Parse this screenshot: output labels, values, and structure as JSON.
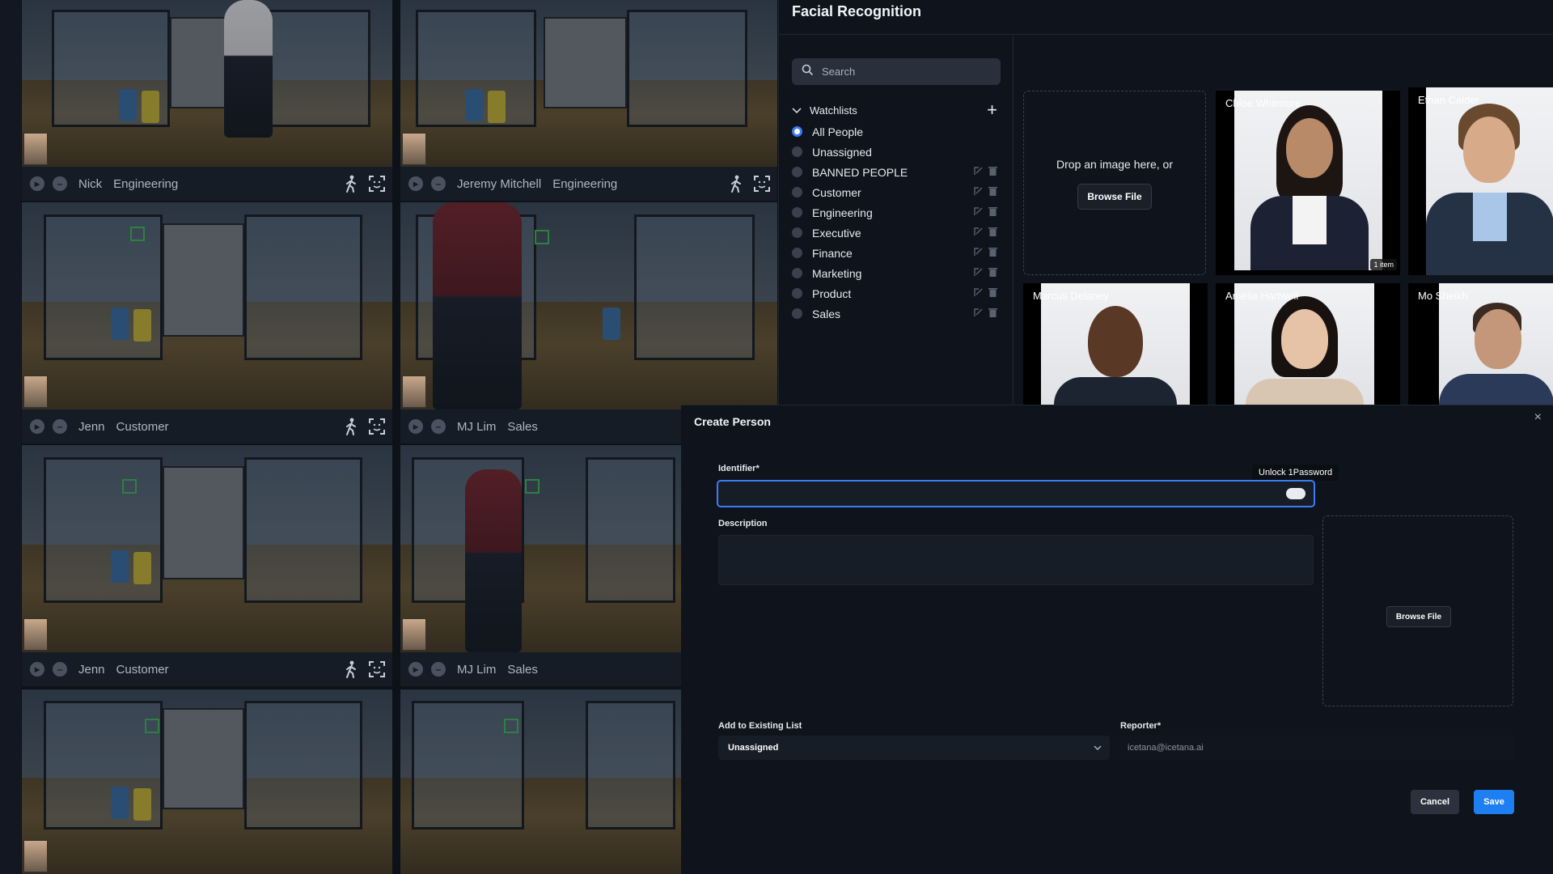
{
  "panel": {
    "title": "Facial Recognition",
    "search_placeholder": "Search",
    "watchlists_label": "Watchlists",
    "watchlists": [
      {
        "label": "All People",
        "selected": true,
        "editable": false
      },
      {
        "label": "Unassigned",
        "selected": false,
        "editable": false
      },
      {
        "label": "BANNED PEOPLE",
        "selected": false,
        "editable": true
      },
      {
        "label": "Customer",
        "selected": false,
        "editable": true
      },
      {
        "label": "Engineering",
        "selected": false,
        "editable": true
      },
      {
        "label": "Executive",
        "selected": false,
        "editable": true
      },
      {
        "label": "Finance",
        "selected": false,
        "editable": true
      },
      {
        "label": "Marketing",
        "selected": false,
        "editable": true
      },
      {
        "label": "Product",
        "selected": false,
        "editable": true
      },
      {
        "label": "Sales",
        "selected": false,
        "editable": true
      }
    ],
    "drop_text": "Drop an image here, or",
    "browse_label": "Browse File",
    "people": [
      {
        "name": "Chloe Whitmore",
        "badge": "1 item"
      },
      {
        "name": "Ethan Calder",
        "badge": ""
      },
      {
        "name": "Marcus Delaney",
        "badge": ""
      },
      {
        "name": "Amelia Hartwell",
        "badge": ""
      },
      {
        "name": "Mo Sheikh",
        "badge": ""
      }
    ]
  },
  "cameras": [
    {
      "name": "Nick",
      "group": "Engineering"
    },
    {
      "name": "Jeremy Mitchell",
      "group": "Engineering"
    },
    {
      "name": "Jenn",
      "group": "Customer"
    },
    {
      "name": "MJ Lim",
      "group": "Sales"
    },
    {
      "name": "Jenn",
      "group": "Customer"
    },
    {
      "name": "MJ Lim",
      "group": "Sales"
    }
  ],
  "modal": {
    "title": "Create Person",
    "identifier_label": "Identifier*",
    "identifier_value": "",
    "password_tooltip": "Unlock 1Password",
    "description_label": "Description",
    "description_value": "",
    "browse_label": "Browse File",
    "list_label": "Add to Existing List",
    "list_value": "Unassigned",
    "reporter_label": "Reporter*",
    "reporter_value": "icetana@icetana.ai",
    "cancel_label": "Cancel",
    "save_label": "Save"
  },
  "colors": {
    "accent": "#1e7ff2",
    "focus": "#3b7cf5",
    "detection": "#3fbf5a"
  }
}
